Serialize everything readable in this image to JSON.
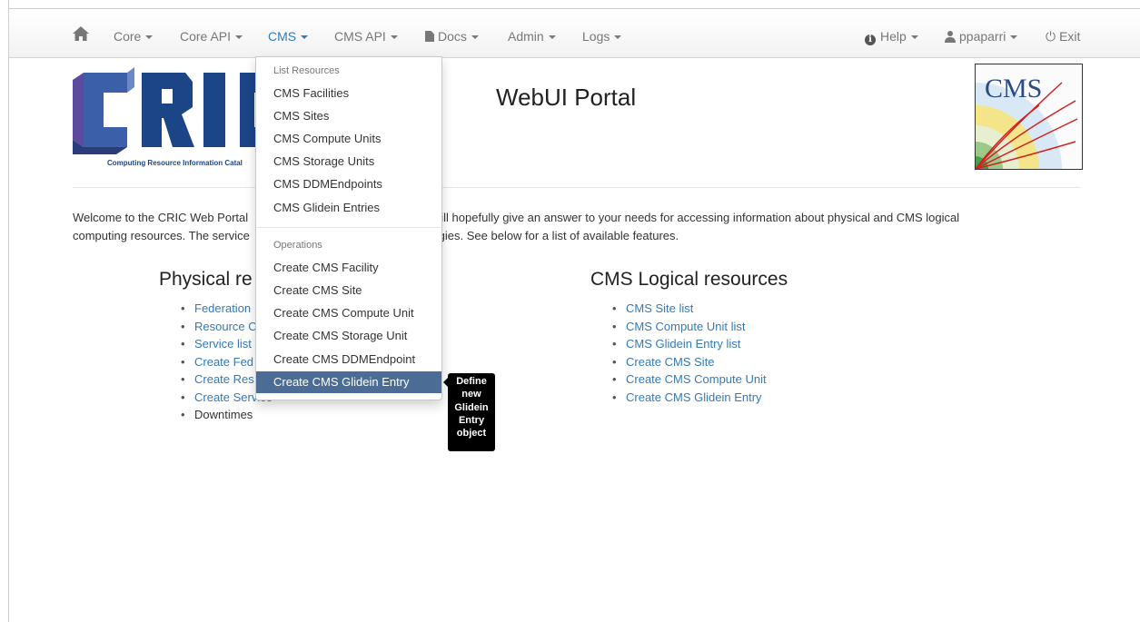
{
  "navbar": {
    "items": [
      {
        "label": "Core"
      },
      {
        "label": "Core API"
      },
      {
        "label": "CMS"
      },
      {
        "label": "CMS API"
      },
      {
        "label": "Docs"
      },
      {
        "label": "Admin"
      },
      {
        "label": "Logs"
      }
    ],
    "right": {
      "help": "Help",
      "user": "ppaparri",
      "exit": "Exit"
    }
  },
  "header": {
    "cric_logo_text": "CRIC",
    "cric_caption": "Computing Resource Information Catal",
    "title": "WebUI Portal",
    "cms_logo_text": "CMS"
  },
  "welcome": {
    "line1_left": "Welcome to the CRIC Web Portal",
    "line1_right": "vice will hopefully give an answer to your needs for accessing information about physical and CMS logical",
    "line2_left": "computing resources. The service",
    "line2_right": "hnologies. See below for a list of available features."
  },
  "physical": {
    "title": "Physical re",
    "items": [
      {
        "label": "Federation"
      },
      {
        "label": "Resource C"
      },
      {
        "label": "Service list"
      },
      {
        "label": "Create Fed"
      },
      {
        "label": "Create Res"
      },
      {
        "label": "Create Service"
      },
      {
        "label": "Downtimes"
      }
    ]
  },
  "logical": {
    "title": "CMS Logical resources",
    "items": [
      {
        "label": "CMS Site list"
      },
      {
        "label": "CMS Compute Unit list"
      },
      {
        "label": "CMS Glidein Entry list"
      },
      {
        "label": "Create CMS Site"
      },
      {
        "label": "Create CMS Compute Unit"
      },
      {
        "label": "Create CMS Glidein Entry"
      }
    ]
  },
  "dropdown": {
    "list_header": "List Resources",
    "list_items": [
      {
        "label": "CMS Facilities"
      },
      {
        "label": "CMS Sites"
      },
      {
        "label": "CMS Compute Units"
      },
      {
        "label": "CMS Storage Units"
      },
      {
        "label": "CMS DDMEndpoints"
      },
      {
        "label": "CMS Glidein Entries"
      }
    ],
    "ops_header": "Operations",
    "ops_items": [
      {
        "label": "Create CMS Facility"
      },
      {
        "label": "Create CMS Site"
      },
      {
        "label": "Create CMS Compute Unit"
      },
      {
        "label": "Create CMS Storage Unit"
      },
      {
        "label": "Create CMS DDMEndpoint"
      },
      {
        "label": "Create CMS Glidein Entry"
      }
    ]
  },
  "tooltip": {
    "lines": [
      "Define",
      "new",
      "Glidein",
      "Entry",
      "object"
    ]
  },
  "colors": {
    "link": "#337ab7",
    "active_menu_bg": "#4a6c95",
    "cric_blue": "#1c4587",
    "cric_purple": "#5b4a9e"
  }
}
